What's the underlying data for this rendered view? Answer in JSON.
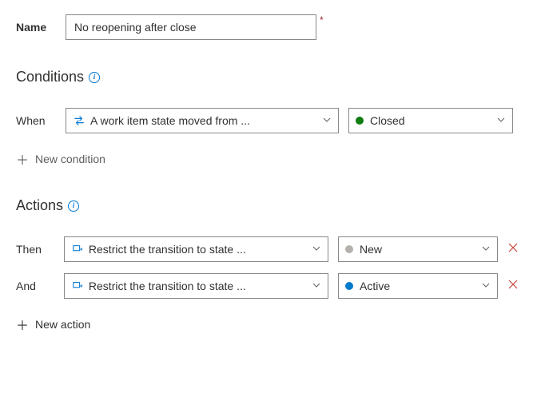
{
  "name": {
    "label": "Name",
    "value": "No reopening after close"
  },
  "conditions": {
    "title": "Conditions",
    "rows": [
      {
        "prefix": "When",
        "main_text": "A work item state moved from ...",
        "value_text": "Closed",
        "dot_color": "green"
      }
    ],
    "add_label": "New condition"
  },
  "actions": {
    "title": "Actions",
    "rows": [
      {
        "prefix": "Then",
        "main_text": "Restrict the transition to state ...",
        "value_text": "New",
        "dot_color": "gray"
      },
      {
        "prefix": "And",
        "main_text": "Restrict the transition to state ...",
        "value_text": "Active",
        "dot_color": "blue"
      }
    ],
    "add_label": "New action"
  }
}
